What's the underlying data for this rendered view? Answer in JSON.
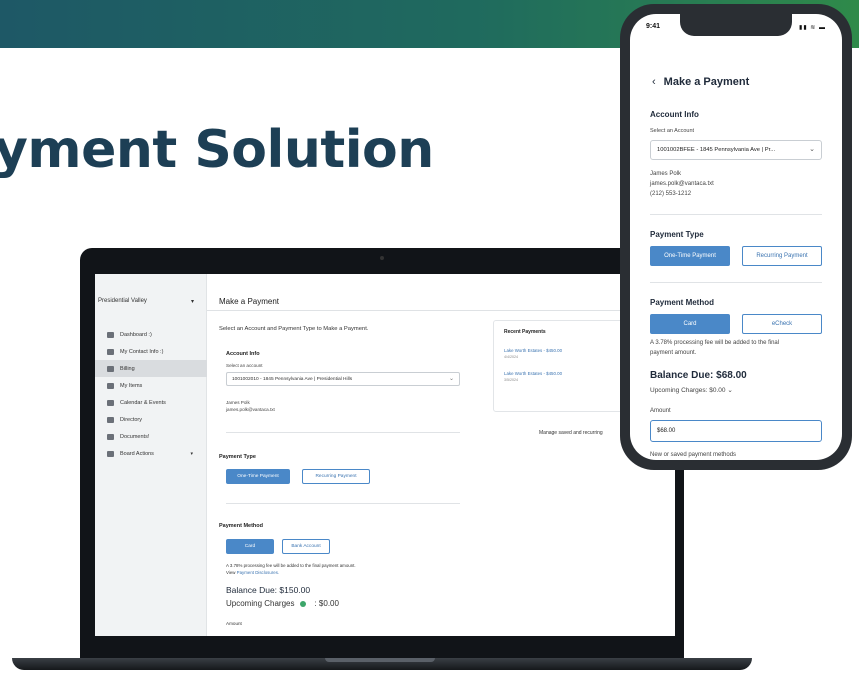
{
  "headline": "yment Solution",
  "laptop": {
    "community": "Presidential Valley",
    "nav": [
      {
        "label": "Dashboard :)",
        "icon": "dashboard-icon"
      },
      {
        "label": "My Contact Info :)",
        "icon": "person-icon"
      },
      {
        "label": "Billing",
        "icon": "billing-icon",
        "active": true
      },
      {
        "label": "My Items",
        "icon": "list-icon"
      },
      {
        "label": "Calendar & Events",
        "icon": "calendar-icon"
      },
      {
        "label": "Directory",
        "icon": "directory-icon"
      },
      {
        "label": "Documents!",
        "icon": "folder-icon"
      },
      {
        "label": "Board Actions",
        "icon": "board-icon",
        "dropdown": true
      }
    ],
    "page_title": "Make a Payment",
    "intro": "Select an Account and Payment Type to Make a Payment.",
    "account_info_heading": "Account Info",
    "select_account_label": "Select an account",
    "account_value": "1001002010 - 1845 Pennsylvania Ave | Presidential Hills",
    "owner_name": "James Polk",
    "owner_email": "james.polk@vantaca.txt",
    "payment_type_heading": "Payment Type",
    "one_time_label": "One-Time Payment",
    "recurring_label": "Recurring Payment",
    "payment_method_heading": "Payment Method",
    "card_label": "Card",
    "bank_label": "Bank Account",
    "fee_text": "A 3.78% processing fee will be added to the final payment amount.",
    "view_link_prefix": "View",
    "view_link": "Payment Disclosures.",
    "balance_due": "Balance Due: $150.00",
    "upcoming_label": "Upcoming Charges",
    "upcoming_value": ": $0.00",
    "amount_label": "Amount",
    "recent": {
      "title": "Recent Payments",
      "items": [
        {
          "name": "Lake Worth Estates - $450.00",
          "date": "4/4/2024"
        },
        {
          "name": "Lake Worth Estates - $450.00",
          "date": "3/5/2024"
        }
      ],
      "view_link": "View"
    },
    "manage_text": "Manage saved and recurring"
  },
  "phone": {
    "time": "9:41",
    "signal": "▮▮ ≋ ▬",
    "back_icon": "‹",
    "title": "Make a Payment",
    "account_info_heading": "Account Info",
    "select_account_label": "Select an Account",
    "account_value": "1001002BFEE - 1845 Pennsylvania Ave | Pr...",
    "owner_name": "James Polk",
    "owner_email": "james.polk@vantaca.txt",
    "owner_phone": "(212) 553-1212",
    "payment_type_heading": "Payment Type",
    "one_time_label": "One-Time Payment",
    "recurring_label": "Recurring Payment",
    "payment_method_heading": "Payment Method",
    "card_label": "Card",
    "echeck_label": "eCheck",
    "fee_text_1": "A 3.78% processing fee will be added to the final",
    "fee_text_2": "payment amount.",
    "balance_due": "Balance Due: $68.00",
    "upcoming": "Upcoming Charges: $0.00",
    "amount_label": "Amount",
    "amount_value": "$68.00",
    "methods_label": "New or saved payment methods"
  },
  "colors": {
    "accent": "#4a88c8",
    "banner_start": "#1e5866",
    "banner_end": "#2f8a4a",
    "headline": "#1d3f55"
  }
}
